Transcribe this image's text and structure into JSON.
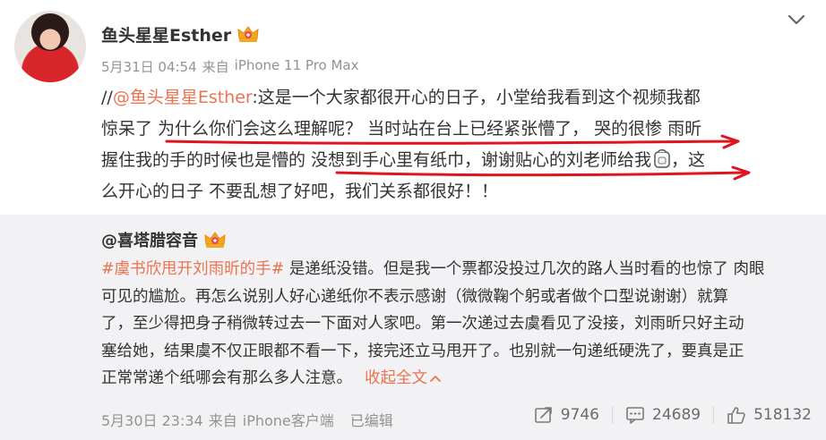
{
  "post": {
    "author": "鱼头星星Esther",
    "time": "5月31日 04:54",
    "source_prefix": "来自",
    "source": "iPhone 11 Pro Max",
    "lines": [
      {
        "pre": "//",
        "mention": "@鱼头星星Esther",
        "text": ":这是一个大家都很开心的日子，小堂给我看到这个视频我都"
      },
      {
        "text": "惊呆了 为什么你们会这么理解呢？ 当时站在台上已经紧张懵了， 哭的很惨 雨昕"
      },
      {
        "text": "握住我的手的时候也是懵的 没想到手心里有纸巾，谢谢贴心的刘老师给我",
        "tail": "，这"
      },
      {
        "text": "么开心的日子 不要乱想了好吧，我们关系都很好！！"
      }
    ]
  },
  "repost": {
    "author": "@喜塔腊容音",
    "lines": [
      {
        "hashtag": "#虞书欣甩开刘雨昕的手#",
        "text": " 是递纸没错。但是我一个票都没投过几次的路人当时看的也惊了 肉眼"
      },
      {
        "text": "可见的尴尬。再怎么说别人好心递纸你不表示感谢（微微鞠个躬或者做个口型说谢谢）就算"
      },
      {
        "text": "了，至少得把身子稍微转过去一下面对人家吧。第一次递过去虞看见了没接，刘雨昕只好主动"
      },
      {
        "text": "塞给她，结果虞不仅正眼都不看一下，接完还立马甩开了。也别就一句递纸硬洗了，要真是正"
      },
      {
        "text": "正常常递个纸哪会有那么多人注意。",
        "collapse": "收起全文"
      }
    ],
    "time": "5月30日 23:34",
    "source_prefix": "来自",
    "source": "iPhone客户端",
    "edited": "已编辑",
    "reposts": "9746",
    "comments": "24689",
    "likes": "518132"
  },
  "colors": {
    "accent": "#eb7350",
    "meta": "#939393",
    "annotation_red": "#e0141e",
    "repost_bg": "#f2f2f5"
  },
  "icons": [
    "crown-vip-icon",
    "chevron-down-icon",
    "tissue-icon",
    "repost-icon",
    "comment-icon",
    "like-icon",
    "chevron-up-icon"
  ]
}
